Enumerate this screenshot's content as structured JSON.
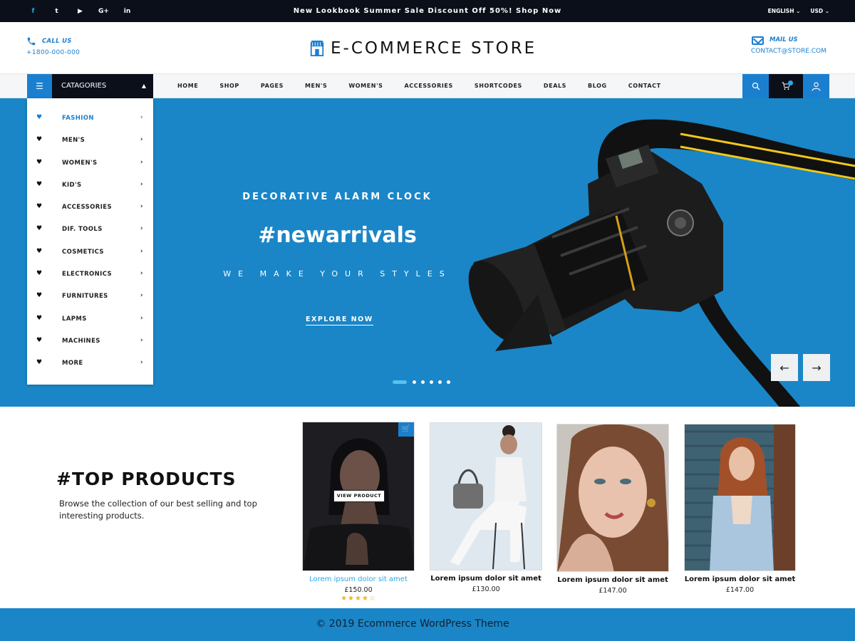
{
  "topbar": {
    "social": [
      {
        "name": "facebook",
        "glyph": "f"
      },
      {
        "name": "twitter",
        "glyph": "t"
      },
      {
        "name": "youtube",
        "glyph": "▶"
      },
      {
        "name": "google-plus",
        "glyph": "G+"
      },
      {
        "name": "linkedin",
        "glyph": "in"
      }
    ],
    "promo": "New Lookbook Summer Sale Discount Off 50%! Shop Now",
    "language": "ENGLISH ⌄",
    "currency": "USD ⌄"
  },
  "header": {
    "call_label": "CALL US",
    "call_value": "+1800-000-000",
    "logo": "E-COMMERCE STORE",
    "mail_label": "MAIL US",
    "mail_value": "CONTACT@STORE.COM"
  },
  "nav": {
    "categories_label": "CATAGORIES",
    "menu": [
      "HOME",
      "SHOP",
      "PAGES",
      "MEN'S",
      "WOMEN'S",
      "ACCESSORIES",
      "SHORTCODES",
      "DEALS",
      "BLOG",
      "CONTACT"
    ]
  },
  "categories": [
    {
      "label": "FASHION",
      "active": true
    },
    {
      "label": "MEN'S"
    },
    {
      "label": "WOMEN'S"
    },
    {
      "label": "KID'S"
    },
    {
      "label": "ACCESSORIES"
    },
    {
      "label": "DIF. TOOLS"
    },
    {
      "label": "COSMETICS"
    },
    {
      "label": "ELECTRONICS"
    },
    {
      "label": "FURNITURES"
    },
    {
      "label": "LAPMS"
    },
    {
      "label": "MACHINES"
    },
    {
      "label": "MORE"
    }
  ],
  "hero": {
    "tagline": "DECORATIVE ALARM CLOCK",
    "title": "#newarrivals",
    "subtitle": "WE MAKE YOUR STYLES",
    "cta": "EXPLORE NOW",
    "slides": 6,
    "active_slide": 1,
    "prev": "←",
    "next": "→"
  },
  "top_products": {
    "title": "#TOP PRODUCTS",
    "description": "Browse the collection of our best selling and top interesting products.",
    "view_button": "VIEW PRODUCT",
    "items": [
      {
        "name": "Lorem ipsum dolor sit amet",
        "price": "£150.00",
        "rating": 4,
        "highlight": true
      },
      {
        "name": "Lorem ipsum dolor sit amet",
        "price": "£130.00"
      },
      {
        "name": "Lorem ipsum dolor sit amet",
        "price": "£147.00"
      },
      {
        "name": "Lorem ipsum dolor sit amet",
        "price": "£147.00"
      }
    ]
  },
  "footer": {
    "copyright": "© 2019 Ecommerce WordPress Theme"
  },
  "colors": {
    "accent": "#1b7fd0",
    "hero_bg": "#1a86c7",
    "dark": "#0b0f1a",
    "star": "#f3b41a"
  }
}
